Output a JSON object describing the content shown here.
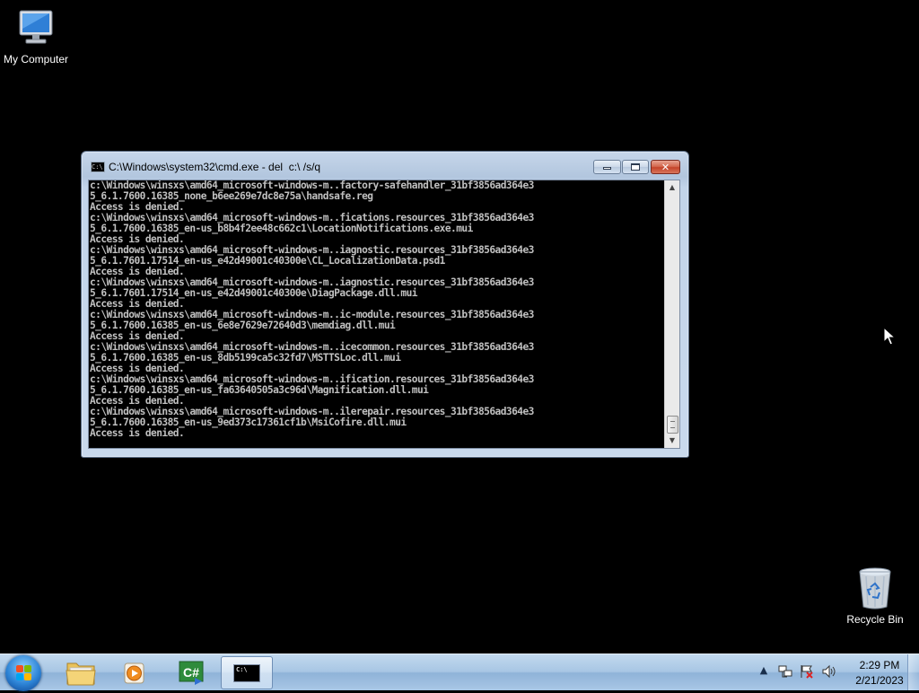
{
  "desktop": {
    "icons": [
      {
        "label": "My Computer"
      },
      {
        "label": "Recycle Bin"
      }
    ]
  },
  "cmd_window": {
    "title": "C:\\Windows\\system32\\cmd.exe - del  c:\\ /s/q",
    "icon_text": "C:\\",
    "output_lines": [
      "c:\\Windows\\winsxs\\amd64_microsoft-windows-m..factory-safehandler_31bf3856ad364e3",
      "5_6.1.7600.16385_none_b6ee269e7dc8e75a\\handsafe.reg",
      "Access is denied.",
      "c:\\Windows\\winsxs\\amd64_microsoft-windows-m..fications.resources_31bf3856ad364e3",
      "5_6.1.7600.16385_en-us_b8b4f2ee48c662c1\\LocationNotifications.exe.mui",
      "Access is denied.",
      "c:\\Windows\\winsxs\\amd64_microsoft-windows-m..iagnostic.resources_31bf3856ad364e3",
      "5_6.1.7601.17514_en-us_e42d49001c40300e\\CL_LocalizationData.psd1",
      "Access is denied.",
      "c:\\Windows\\winsxs\\amd64_microsoft-windows-m..iagnostic.resources_31bf3856ad364e3",
      "5_6.1.7601.17514_en-us_e42d49001c40300e\\DiagPackage.dll.mui",
      "Access is denied.",
      "c:\\Windows\\winsxs\\amd64_microsoft-windows-m..ic-module.resources_31bf3856ad364e3",
      "5_6.1.7600.16385_en-us_6e8e7629e72640d3\\memdiag.dll.mui",
      "Access is denied.",
      "c:\\Windows\\winsxs\\amd64_microsoft-windows-m..icecommon.resources_31bf3856ad364e3",
      "5_6.1.7600.16385_en-us_8db5199ca5c32fd7\\MSTTSLoc.dll.mui",
      "Access is denied.",
      "c:\\Windows\\winsxs\\amd64_microsoft-windows-m..ification.resources_31bf3856ad364e3",
      "5_6.1.7600.16385_en-us_fa63640505a3c96d\\Magnification.dll.mui",
      "Access is denied.",
      "c:\\Windows\\winsxs\\amd64_microsoft-windows-m..ilerepair.resources_31bf3856ad364e3",
      "5_6.1.7600.16385_en-us_9ed373c17361cf1b\\MsiCofire.dll.mui",
      "Access is denied."
    ]
  },
  "taskbar": {
    "items": [
      "start-button",
      "explorer-icon",
      "media-player-icon",
      "csharp-icon",
      "cmd-icon"
    ],
    "clock": {
      "time": "2:29 PM",
      "date": "2/21/2023"
    }
  },
  "colors": {
    "console_text": "#c0c0c0",
    "console_bg": "#000000",
    "close_button": "#c4432a"
  }
}
